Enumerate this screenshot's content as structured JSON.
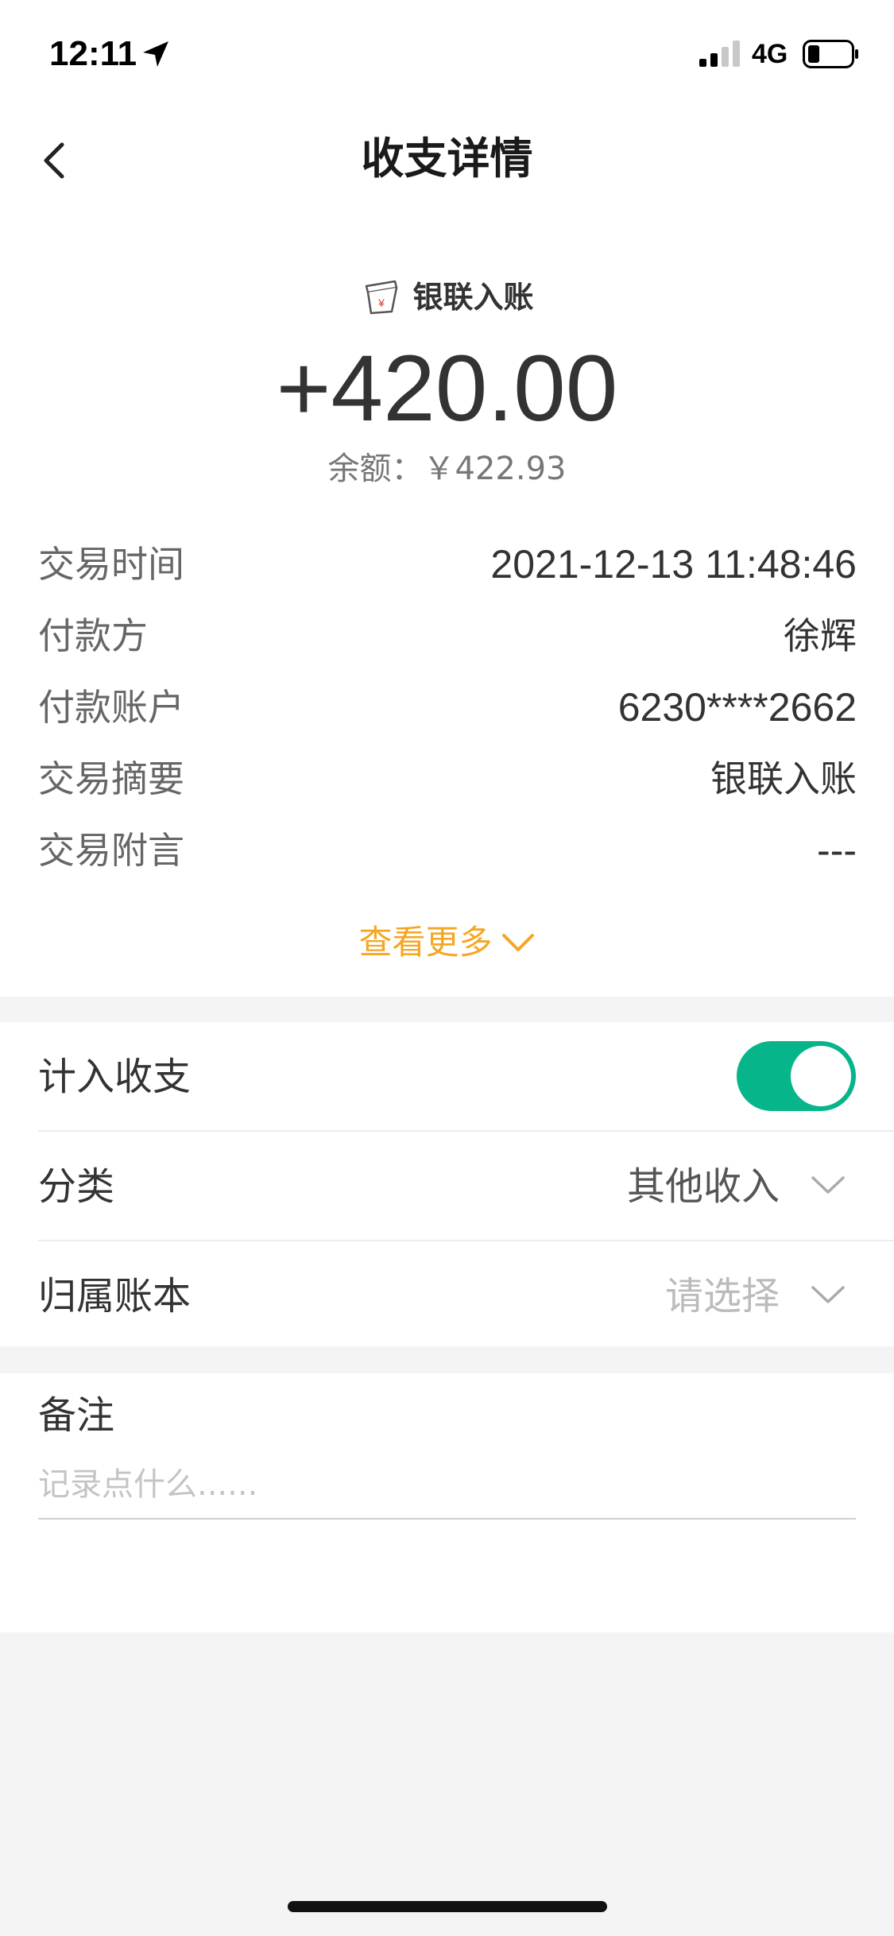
{
  "status_bar": {
    "time": "12:11",
    "network": "4G",
    "icons": [
      "location-arrow-icon",
      "signal-icon",
      "battery-icon"
    ]
  },
  "nav": {
    "title": "收支详情",
    "back_icon": "chevron-left-icon"
  },
  "transaction": {
    "source_icon": "unionpay-bucket-icon",
    "source": "银联入账",
    "amount": "+420.00",
    "balance_label": "余额：",
    "balance_value": "￥422.93"
  },
  "details": [
    {
      "label": "交易时间",
      "value": "2021-12-13 11:48:46"
    },
    {
      "label": "付款方",
      "value": "徐辉"
    },
    {
      "label": "付款账户",
      "value": "6230****2662"
    },
    {
      "label": "交易摘要",
      "value": "银联入账"
    },
    {
      "label": "交易附言",
      "value": "---"
    }
  ],
  "view_more": {
    "label": "查看更多",
    "icon": "chevron-down-icon"
  },
  "settings": {
    "include": {
      "label": "计入收支",
      "on": true
    },
    "category": {
      "label": "分类",
      "value": "其他收入"
    },
    "account_book": {
      "label": "归属账本",
      "placeholder": "请选择"
    }
  },
  "note": {
    "label": "备注",
    "placeholder": "记录点什么......"
  },
  "colors": {
    "accent_orange": "#f5a623",
    "toggle_green": "#07b58a",
    "background": "#f4f4f4"
  }
}
